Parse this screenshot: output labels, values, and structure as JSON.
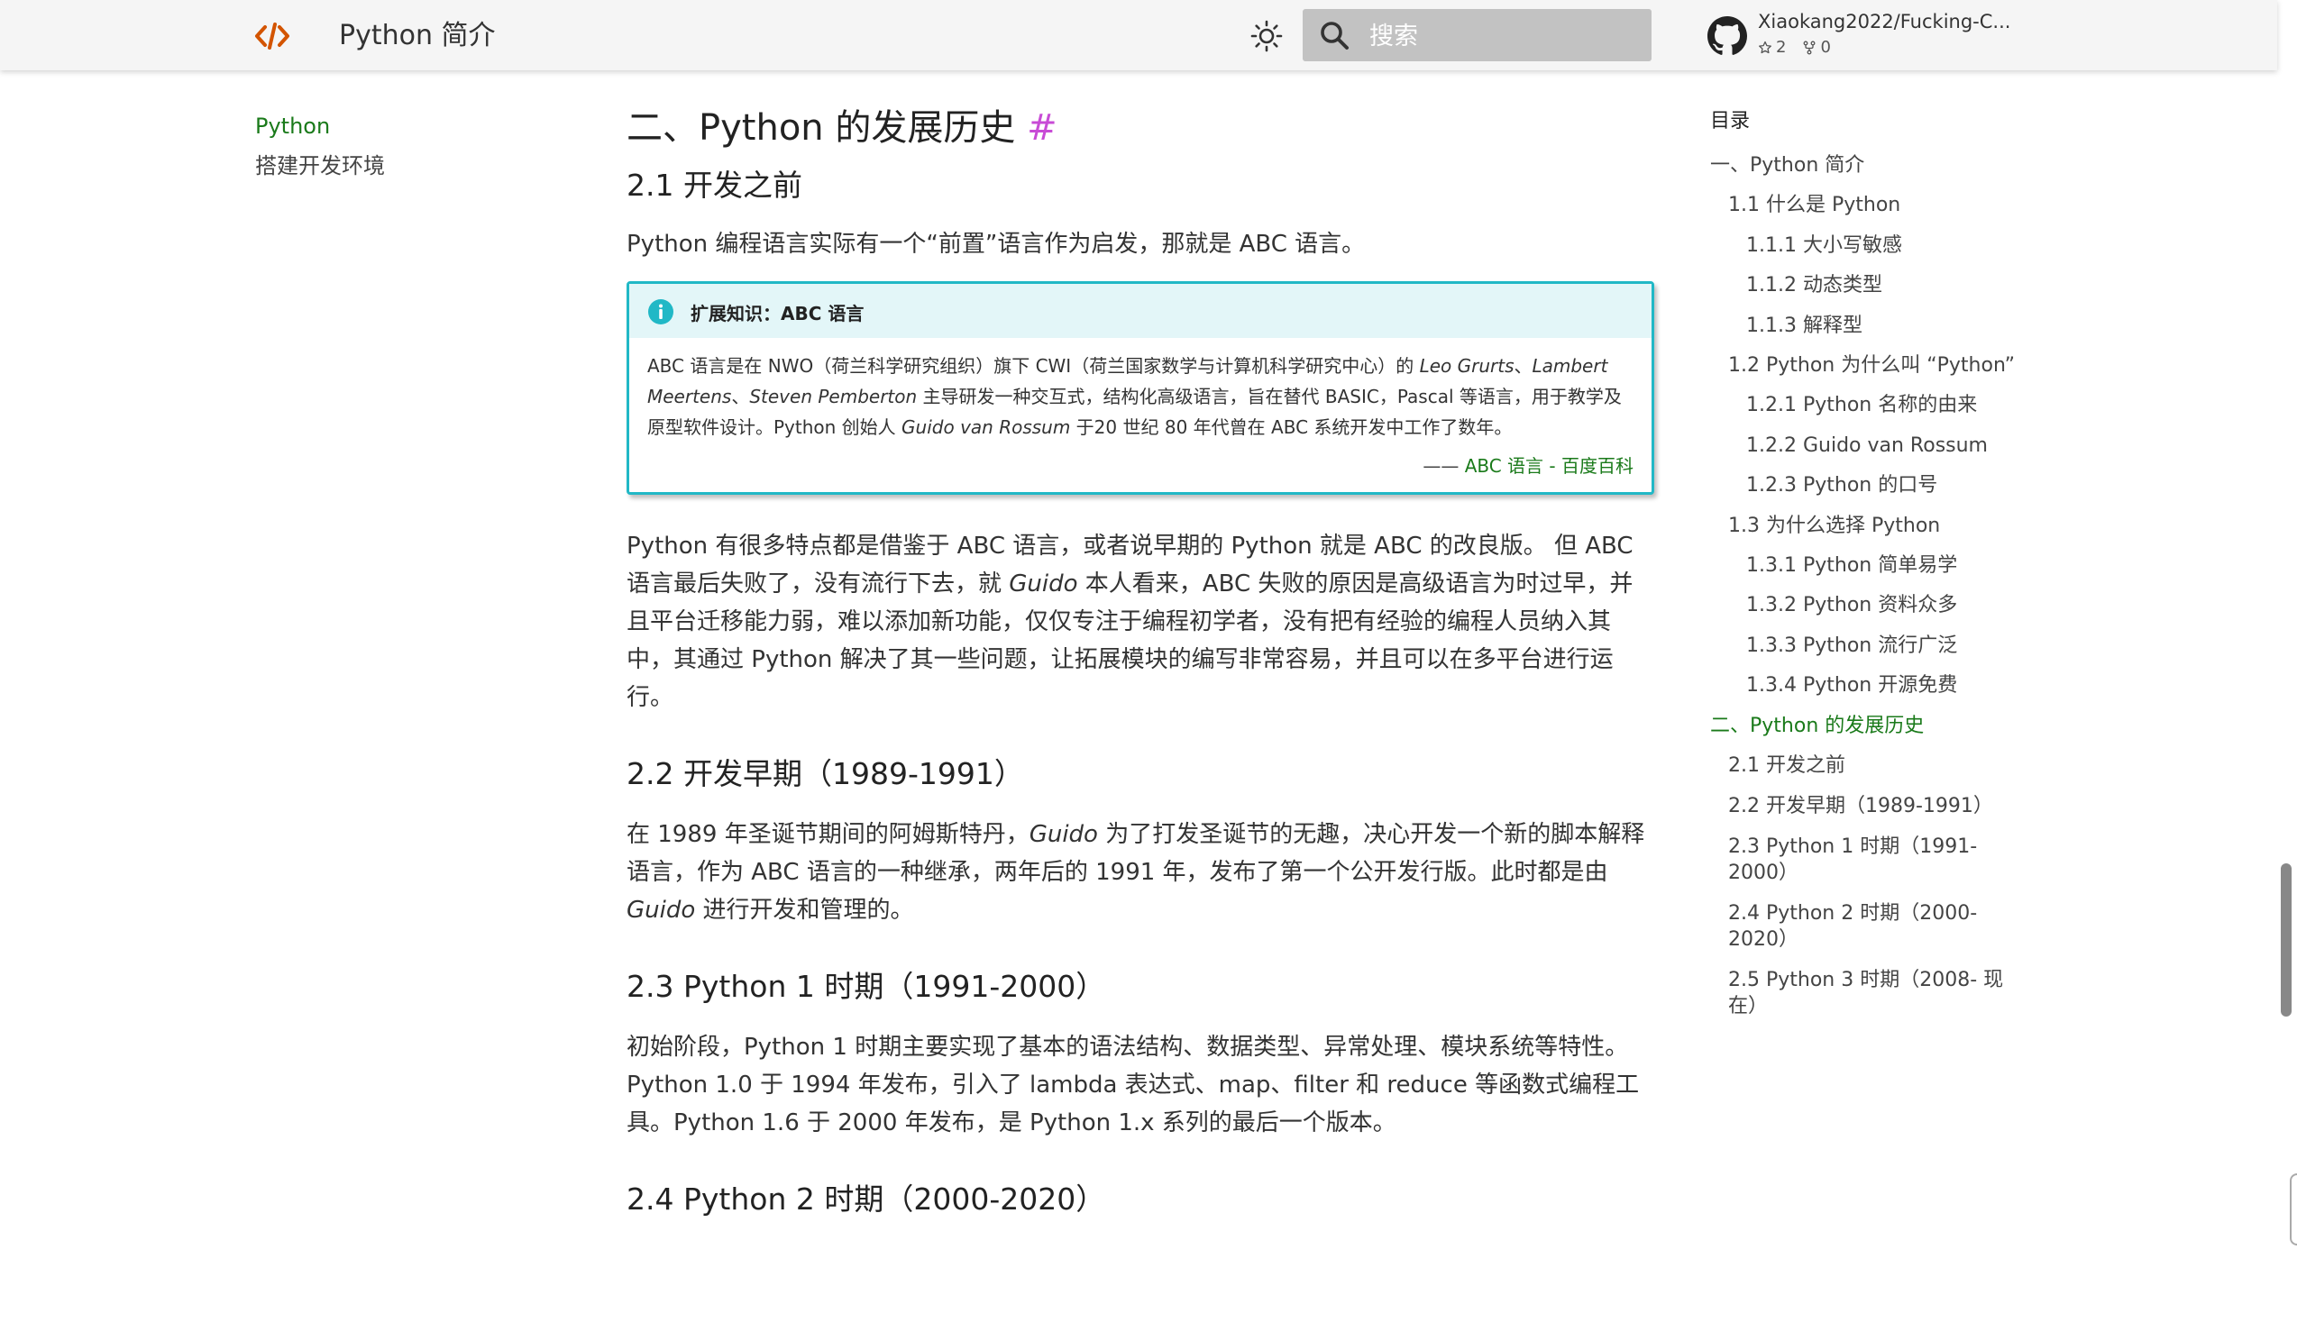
{
  "header": {
    "title": "Python 简介",
    "search_placeholder": "搜索",
    "repo_name": "Xiaokang2022/Fucking-C...",
    "stars": "2",
    "forks": "0"
  },
  "left_nav": {
    "items": [
      {
        "label": "Python",
        "active": true
      },
      {
        "label": "搭建开发环境",
        "active": false
      }
    ]
  },
  "main": {
    "h2": "二、Python 的发展历史",
    "anchor": "#",
    "s21": {
      "title": "2.1 开发之前",
      "p1": "Python 编程语言实际有一个“前置”语言作为启发，那就是 ABC 语言。",
      "admonition": {
        "title": "扩展知识：ABC 语言",
        "body_pre": "ABC 语言是在 NWO（荷兰科学研究组织）旗下 CWI（荷兰国家数学与计算机科学研究中心）的 ",
        "name1": "Leo Grurts",
        "sep1": "、",
        "name2": "Lambert Meertens",
        "sep2": "、",
        "name3": "Steven Pemberton",
        "body_mid": " 主导研发一种交互式，结构化高级语言，旨在替代 BASIC，Pascal 等语言，用于教学及原型软件设计。Python 创始人 ",
        "name4": "Guido van Rossum",
        "body_post": " 于20 世纪 80 年代曾在 ABC 系统开发中工作了数年。",
        "source_dash": "—— ",
        "source": "ABC 语言 - 百度百科"
      },
      "p2_pre": "Python 有很多特点都是借鉴于 ABC 语言，或者说早期的 Python 就是 ABC 的改良版。  但 ABC 语言最后失败了，没有流行下去，就 ",
      "p2_name": "Guido",
      "p2_post": " 本人看来，ABC 失败的原因是高级语言为时过早，并且平台迁移能力弱，难以添加新功能，仅仅专注于编程初学者，没有把有经验的编程人员纳入其中，其通过 Python  解决了其一些问题，让拓展模块的编写非常容易，并且可以在多平台进行运行。"
    },
    "s22": {
      "title": "2.2 开发早期（1989-1991）",
      "p_pre": "在 1989 年圣诞节期间的阿姆斯特丹，",
      "p_name1": "Guido",
      "p_mid": " 为了打发圣诞节的无趣，决心开发一个新的脚本解释语言，作为 ABC 语言的一种继承，两年后的 1991 年，发布了第一个公开发行版。此时都是由 ",
      "p_name2": "Guido",
      "p_post": " 进行开发和管理的。"
    },
    "s23": {
      "title": "2.3 Python 1 时期（1991-2000）",
      "p": "初始阶段，Python 1 时期主要实现了基本的语法结构、数据类型、异常处理、模块系统等特性。Python 1.0 于 1994 年发布，引入了 lambda 表达式、map、filter 和 reduce 等函数式编程工具。Python 1.6 于 2000 年发布，是 Python 1.x 系列的最后一个版本。"
    },
    "s24": {
      "title": "2.4 Python 2 时期（2000-2020）"
    }
  },
  "toc": {
    "title": "目录",
    "items": [
      {
        "label": "一、Python 简介",
        "level": 1
      },
      {
        "label": "1.1 什么是 Python",
        "level": 2
      },
      {
        "label": "1.1.1 大小写敏感",
        "level": 3
      },
      {
        "label": "1.1.2 动态类型",
        "level": 3
      },
      {
        "label": "1.1.3 解释型",
        "level": 3
      },
      {
        "label": "1.2 Python 为什么叫 “Python”",
        "level": 2
      },
      {
        "label": "1.2.1 Python 名称的由来",
        "level": 3
      },
      {
        "label": "1.2.2 Guido van Rossum",
        "level": 3
      },
      {
        "label": "1.2.3 Python 的口号",
        "level": 3
      },
      {
        "label": "1.3 为什么选择 Python",
        "level": 2
      },
      {
        "label": "1.3.1 Python 简单易学",
        "level": 3
      },
      {
        "label": "1.3.2 Python 资料众多",
        "level": 3
      },
      {
        "label": "1.3.3 Python 流行广泛",
        "level": 3
      },
      {
        "label": "1.3.4 Python 开源免费",
        "level": 3
      },
      {
        "label": "二、Python 的发展历史",
        "level": 1,
        "active": true
      },
      {
        "label": "2.1 开发之前",
        "level": 2
      },
      {
        "label": "2.2 开发早期（1989-1991）",
        "level": 2
      },
      {
        "label": "2.3 Python 1 时期（1991-2000）",
        "level": 2
      },
      {
        "label": "2.4 Python 2 时期（2000-2020）",
        "level": 2
      },
      {
        "label": "2.5 Python 3 时期（2008- 现在）",
        "level": 2
      }
    ]
  },
  "colors": {
    "accent_green": "#1a7a1a",
    "admonition_border": "#21b8c6",
    "anchor": "#c84bd6",
    "logo": "#d35400"
  }
}
